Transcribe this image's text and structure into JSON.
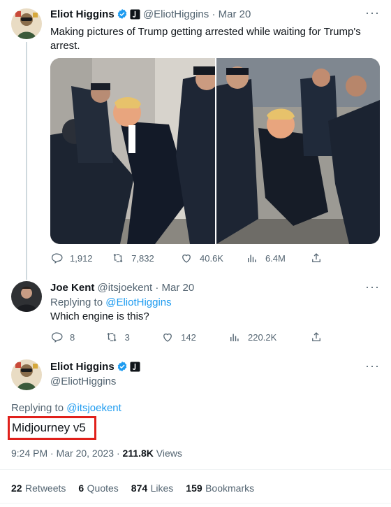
{
  "tweet1": {
    "name": "Eliot Higgins",
    "handle": "@EliotHiggins",
    "date": "Mar 20",
    "text": "Making pictures of Trump getting arrested while waiting for Trump's arrest.",
    "stats": {
      "replies": "1,912",
      "retweets": "7,832",
      "likes": "40.6K",
      "views": "6.4M"
    }
  },
  "reply": {
    "name": "Joe Kent",
    "handle": "@itsjoekent",
    "date": "Mar 20",
    "replying_prefix": "Replying to",
    "replying_to": "@EliotHiggins",
    "text": "Which engine is this?",
    "stats": {
      "replies": "8",
      "retweets": "3",
      "likes": "142",
      "views": "220.2K"
    }
  },
  "main": {
    "name": "Eliot Higgins",
    "handle": "@EliotHiggins",
    "replying_prefix": "Replying to",
    "replying_to": "@itsjoekent",
    "text": "Midjourney v5",
    "timestamp": "9:24 PM · Mar 20, 2023 ·",
    "views_count": "211.8K",
    "views_label": "Views",
    "engagement": [
      {
        "count": "22",
        "label": "Retweets"
      },
      {
        "count": "6",
        "label": "Quotes"
      },
      {
        "count": "874",
        "label": "Likes"
      },
      {
        "count": "159",
        "label": "Bookmarks"
      }
    ]
  },
  "colors": {
    "accent": "#1d9bf0",
    "highlight_box": "#e0201b",
    "muted": "#536471"
  },
  "icons": [
    "reply-icon",
    "retweet-icon",
    "like-icon",
    "views-icon",
    "share-icon",
    "verified-icon",
    "more-icon"
  ]
}
